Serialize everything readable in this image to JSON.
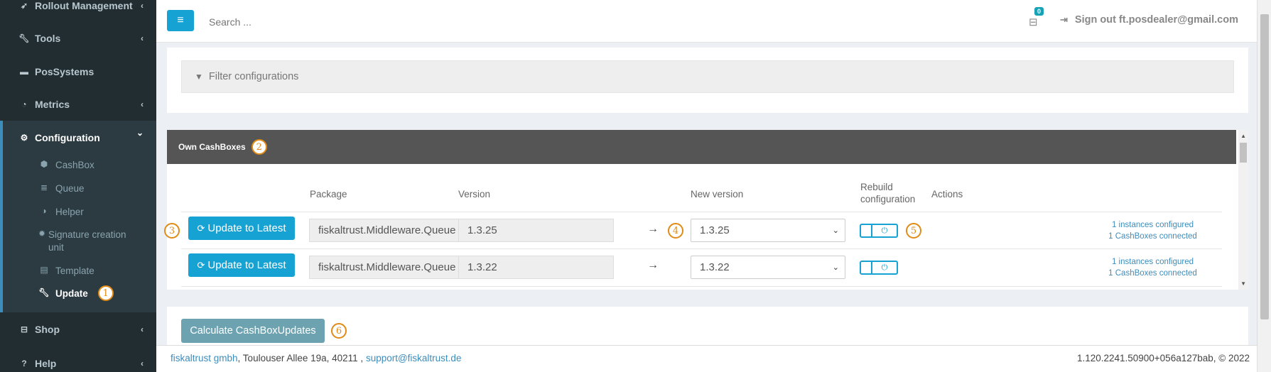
{
  "sidebar": {
    "items": [
      {
        "label": "Rollout Management",
        "icon": "rocket-icon",
        "chevron": "‹"
      },
      {
        "label": "Tools",
        "icon": "wrench-icon",
        "chevron": "‹"
      },
      {
        "label": "PosSystems",
        "icon": "briefcase-icon",
        "chevron": ""
      },
      {
        "label": "Metrics",
        "icon": "metrics-icon",
        "chevron": "‹"
      },
      {
        "label": "Configuration",
        "icon": "cogs-icon",
        "chevron": "⌄"
      },
      {
        "label": "Shop",
        "icon": "basket-icon",
        "chevron": "‹"
      },
      {
        "label": "Help",
        "icon": "question-icon",
        "chevron": "‹"
      }
    ],
    "sub_items": [
      {
        "label": "CashBox",
        "icon": "cube-icon"
      },
      {
        "label": "Queue",
        "icon": "database-icon"
      },
      {
        "label": "Helper",
        "icon": "half-circle-icon"
      },
      {
        "label": "Signature creation unit",
        "icon": "gear-icon"
      },
      {
        "label": "Template",
        "icon": "file-icon"
      },
      {
        "label": "Update",
        "icon": "wrench-icon"
      }
    ]
  },
  "markers": [
    "1",
    "2",
    "3",
    "4",
    "5",
    "6"
  ],
  "topbar": {
    "menu_icon": "≡",
    "search_placeholder": "Search ...",
    "cart_count": "0",
    "signout_label": "Sign out ft.posdealer@gmail.com"
  },
  "filter": {
    "placeholder": "Filter configurations"
  },
  "cashboxes": {
    "title": "Own CashBoxes",
    "headers": {
      "package": "Package",
      "version": "Version",
      "new_version": "New version",
      "rebuild": "Rebuild configuration",
      "actions": "Actions"
    },
    "rows": [
      {
        "button_label": "Update to Latest",
        "package": "fiskaltrust.Middleware.Queue",
        "version": "1.3.25",
        "arrow": "→",
        "new_version": "1.3.25",
        "instances": "1 instances configured",
        "connected": "1 CashBoxes connected"
      },
      {
        "button_label": "Update to Latest",
        "package": "fiskaltrust.Middleware.Queue",
        "version": "1.3.22",
        "arrow": "→",
        "new_version": "1.3.22",
        "instances": "1 instances configured",
        "connected": "1 CashBoxes connected"
      }
    ]
  },
  "calculate_label": "Calculate CashBoxUpdates",
  "footer": {
    "company": "fiskaltrust gmbh",
    "address": ", Toulouser Allee 19a, 40211 , ",
    "email": "support@fiskaltrust.de",
    "version": "1.120.2241.50900+056a127bab, © 2022"
  },
  "colors": {
    "accent": "#17a2d4",
    "sidebar_bg": "#222d32",
    "marker": "#e08b16",
    "header_bg": "#555555"
  }
}
